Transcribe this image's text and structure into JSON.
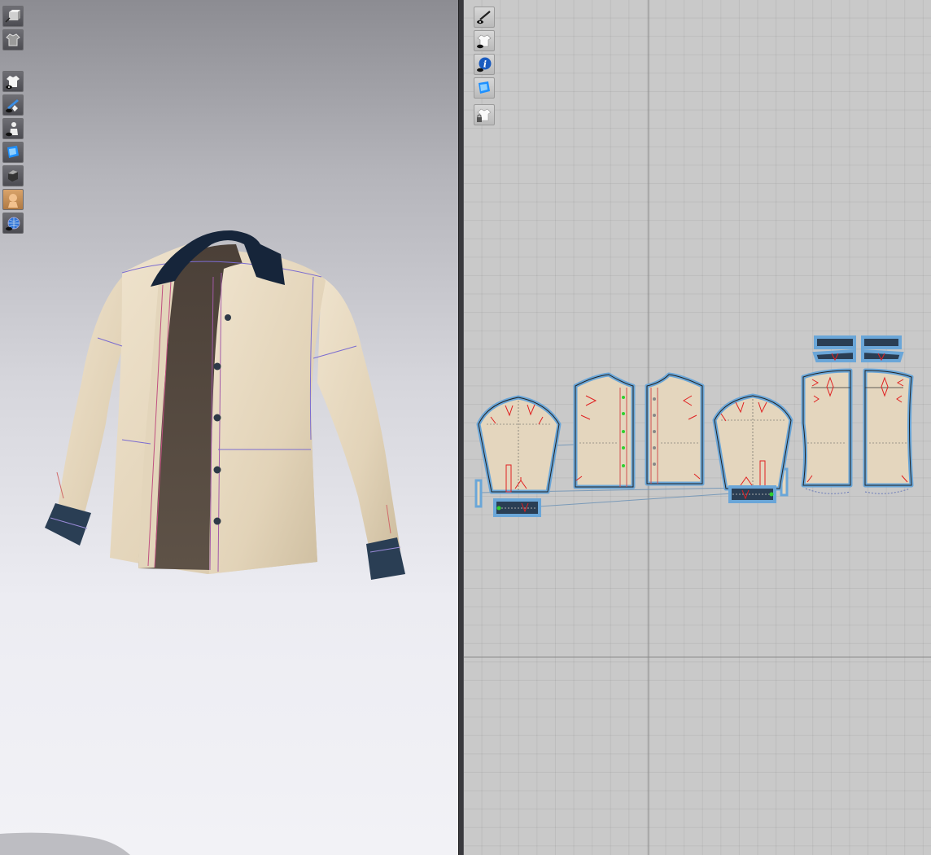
{
  "app": {
    "views": [
      "3d-view",
      "2d-pattern-view"
    ]
  },
  "toolbar_3d": {
    "icons": [
      "box-view-icon",
      "garment-outline-icon",
      "garment-visibility-icon",
      "avatar-brush-icon",
      "avatar-visibility-icon",
      "fabric-texture-icon",
      "camera-icon",
      "avatar-head-icon",
      "world-grid-icon"
    ]
  },
  "toolbar_2d": {
    "icons": [
      "needle-visibility-icon",
      "pattern-garment-icon",
      "info-icon",
      "fabric-2d-icon",
      "lock-garment-icon"
    ]
  },
  "colors": {
    "fabric": "#e4d6be",
    "collar": "#14243a",
    "cuff": "#2a3e54",
    "lining": "#5a4e44",
    "pattern_outline": "#6aa6d8",
    "notch": "#e02020",
    "button": "#2e3a48"
  },
  "pieces": [
    "sleeve-left",
    "front-left",
    "front-right",
    "sleeve-right",
    "back-left",
    "back-right",
    "collar-band",
    "collar",
    "cuff-left",
    "cuff-right",
    "placket-left",
    "placket-right"
  ]
}
